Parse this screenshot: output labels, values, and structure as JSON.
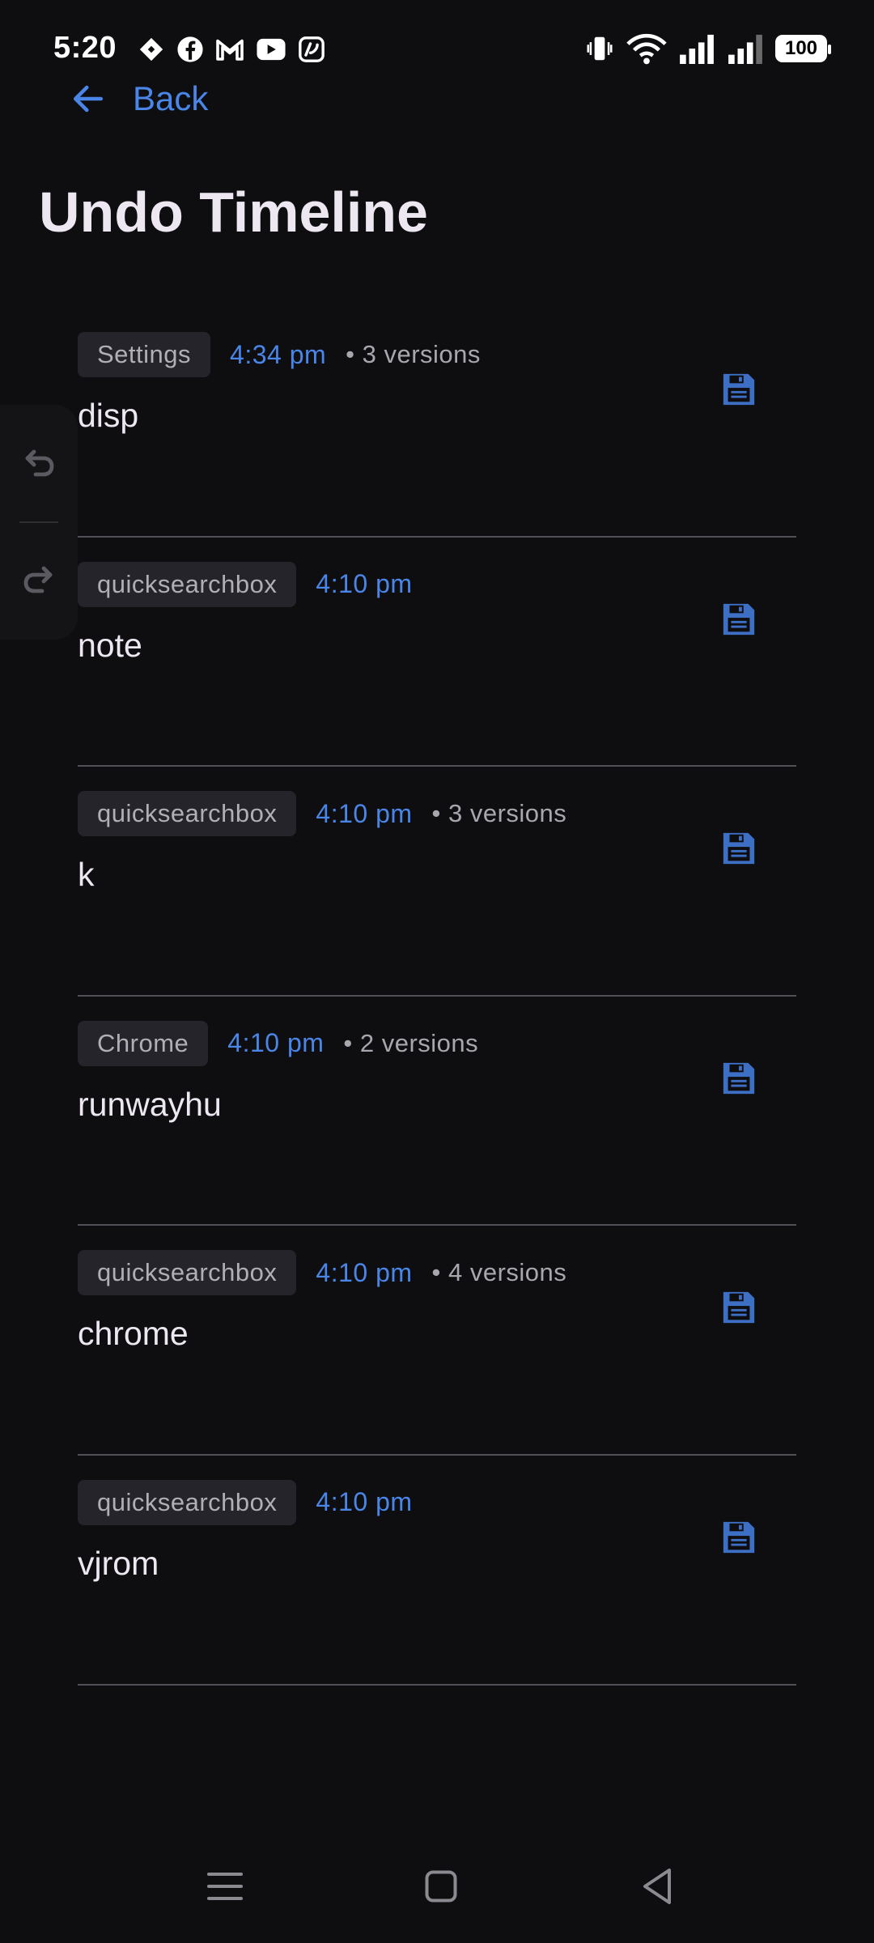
{
  "status_bar": {
    "time": "5:20",
    "battery_level": "100",
    "notification_icons": [
      "diamond-icon",
      "facebook-icon",
      "gmail-icon",
      "youtube-icon",
      "app-icon"
    ],
    "system_icons": [
      "vibrate-icon",
      "wifi-icon",
      "signal-icon",
      "signal-icon"
    ]
  },
  "header": {
    "back_label": "Back",
    "title": "Undo Timeline"
  },
  "timeline": {
    "items": [
      {
        "app": "Settings",
        "time": "4:34 pm",
        "versions": "• 3 versions",
        "text": "disp"
      },
      {
        "app": "quicksearchbox",
        "time": "4:10 pm",
        "versions": "",
        "text": "note"
      },
      {
        "app": "quicksearchbox",
        "time": "4:10 pm",
        "versions": "• 3 versions",
        "text": "k"
      },
      {
        "app": "Chrome",
        "time": "4:10 pm",
        "versions": "• 2 versions",
        "text": "runwayhu"
      },
      {
        "app": "quicksearchbox",
        "time": "4:10 pm",
        "versions": "• 4 versions",
        "text": "chrome"
      },
      {
        "app": "quicksearchbox",
        "time": "4:10 pm",
        "versions": "",
        "text": "vjrom"
      }
    ]
  },
  "colors": {
    "background": "#0e0e11",
    "accent": "#4a86e8",
    "save_icon": "#3d6fc4",
    "chip_background": "#24242a",
    "divider": "#505056"
  },
  "icons": {
    "back": "arrow-left-icon",
    "save": "floppy-disk-icon",
    "undo": "undo-icon",
    "redo": "redo-icon",
    "nav_menu": "menu-icon",
    "nav_home": "home-icon",
    "nav_back": "back-triangle-icon"
  }
}
